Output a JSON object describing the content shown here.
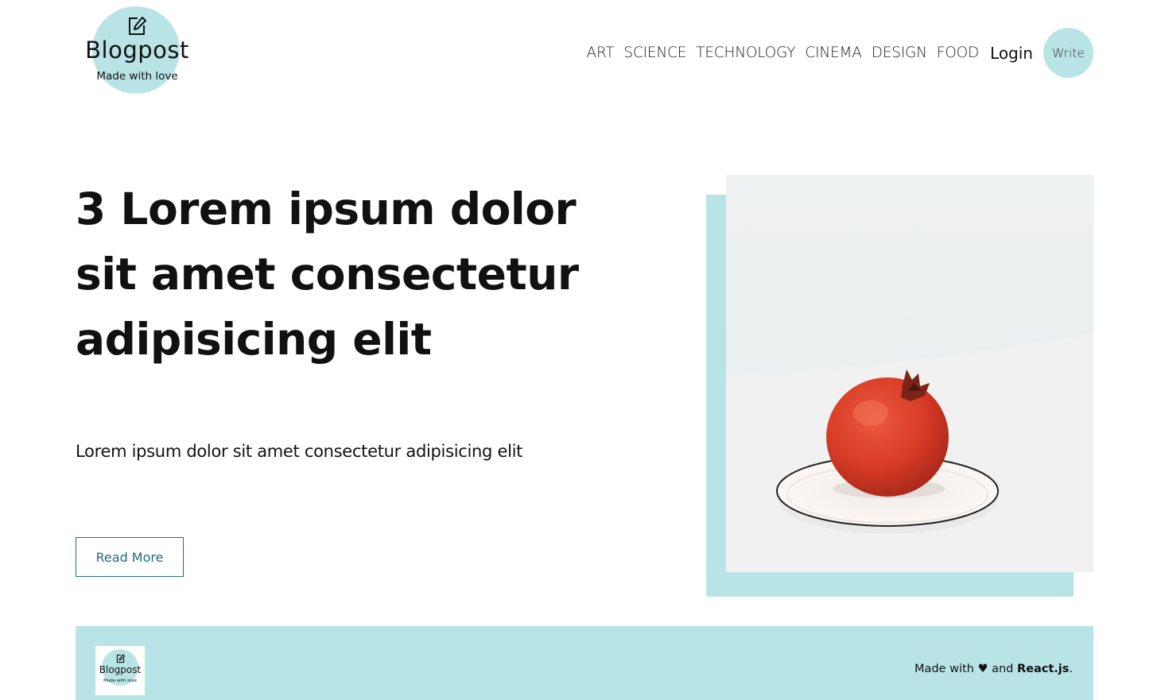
{
  "logo": {
    "title": "Blogpost",
    "subtitle": "Made with love",
    "icon": "edit-icon"
  },
  "nav": {
    "links": [
      "ART",
      "SCIENCE",
      "TECHNOLOGY",
      "CINEMA",
      "DESIGN",
      "FOOD"
    ],
    "login": "Login",
    "write": "Write"
  },
  "hero": {
    "title": "3 Lorem ipsum dolor sit amet consectetur adipisicing elit",
    "description": "Lorem ipsum dolor sit amet consectetur adipisicing elit",
    "button": "Read More",
    "image": "pomegranate-on-plate"
  },
  "footer": {
    "logo_title": "Blogpost",
    "logo_subtitle": "Made with love",
    "text_prefix": "Made with",
    "heart": "♥",
    "text_and": "and",
    "text_brand": "React.js",
    "text_suffix": "."
  },
  "colors": {
    "accent": "#b9e4e6",
    "button_border": "#1f6f75"
  }
}
